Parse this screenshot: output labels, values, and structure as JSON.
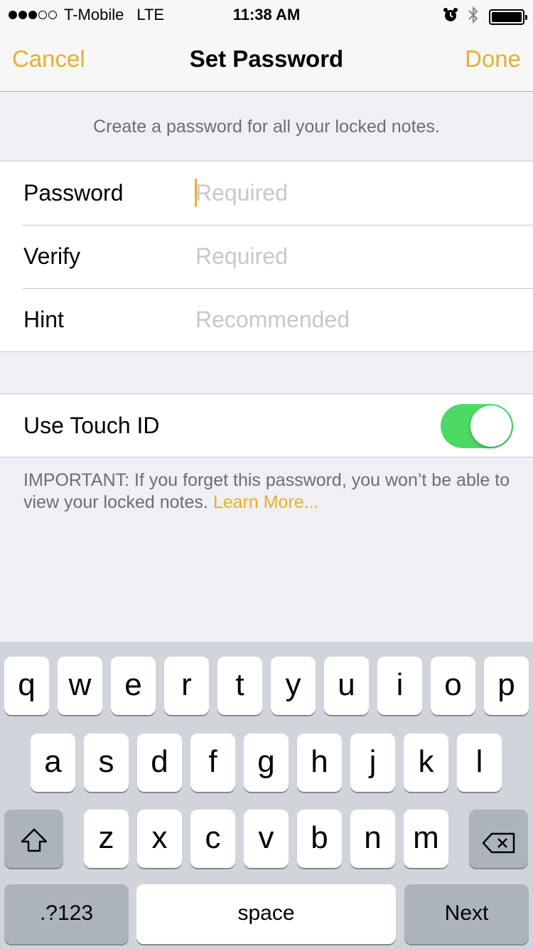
{
  "status_bar": {
    "signal_bars_full": 3,
    "signal_bars_empty": 2,
    "carrier": "T-Mobile",
    "network": "LTE",
    "time": "11:38 AM",
    "icons": [
      "alarm-icon",
      "bluetooth-icon",
      "battery-icon"
    ]
  },
  "nav": {
    "cancel_label": "Cancel",
    "title": "Set Password",
    "done_label": "Done"
  },
  "header_text": "Create a password for all your locked notes.",
  "fields": [
    {
      "label": "Password",
      "placeholder": "Required",
      "focused": true
    },
    {
      "label": "Verify",
      "placeholder": "Required",
      "focused": false
    },
    {
      "label": "Hint",
      "placeholder": "Recommended",
      "focused": false
    }
  ],
  "touch_id": {
    "label": "Use Touch ID",
    "enabled": true
  },
  "footer": {
    "note": "IMPORTANT: If you forget this password, you won’t be able to view your locked notes.",
    "link": "Learn More..."
  },
  "keyboard": {
    "row1": [
      "q",
      "w",
      "e",
      "r",
      "t",
      "y",
      "u",
      "i",
      "o",
      "p"
    ],
    "row2": [
      "a",
      "s",
      "d",
      "f",
      "g",
      "h",
      "j",
      "k",
      "l"
    ],
    "row3": [
      "z",
      "x",
      "c",
      "v",
      "b",
      "n",
      "m"
    ],
    "shift_icon": "shift-icon",
    "delete_icon": "backspace-icon",
    "numbers_label": ".?123",
    "space_label": "space",
    "next_label": "Next"
  },
  "colors": {
    "accent": "#e5b12d",
    "toggle_on": "#4cd964",
    "background": "#efeff4"
  }
}
